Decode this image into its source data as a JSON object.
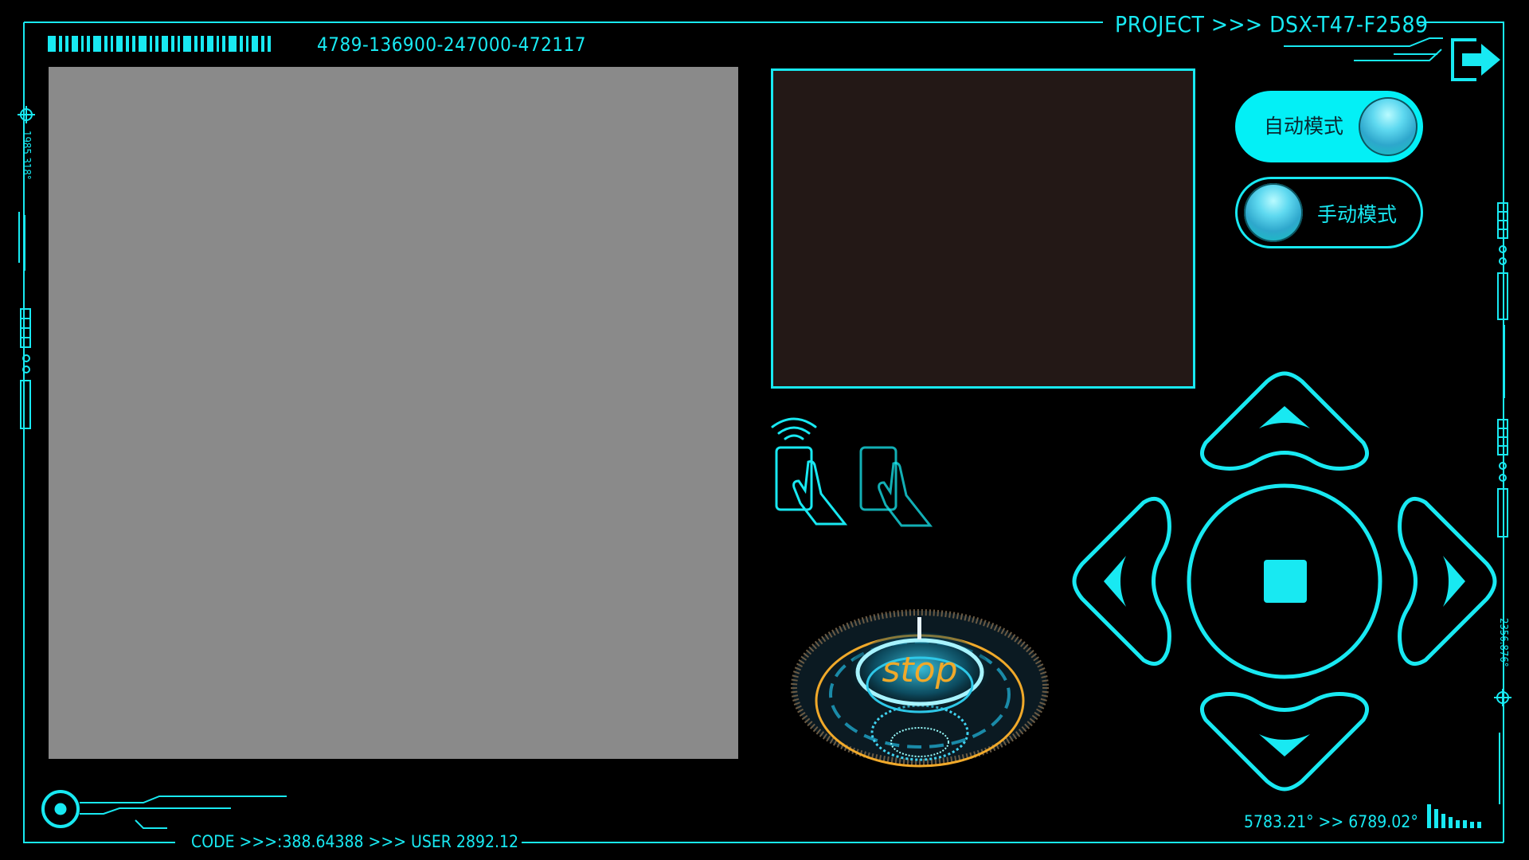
{
  "header": {
    "serial": "4789-136900-247000-472117",
    "project": "PROJECT >>> DSX-T47-F2589"
  },
  "modes": {
    "auto_label": "自动模式",
    "manual_label": "手动模式",
    "active": "auto"
  },
  "stop_button": {
    "label": "stop"
  },
  "footer": {
    "code": "CODE >>>:388.64388 >>> USER 2892.12",
    "coords": "5783.21° >> 6789.02°"
  },
  "side": {
    "left_readout": "1985.318°",
    "right_readout": "2356.876°"
  },
  "colors": {
    "accent": "#18e9f2",
    "video_bg": "#8a8a8a",
    "screen_bg": "#231816",
    "stop_ring": "#f0a92a"
  },
  "icons": {
    "exit": "exit-icon",
    "nfc": "nfc-card-icon",
    "card": "card-tap-icon",
    "dpad": "direction-pad"
  }
}
